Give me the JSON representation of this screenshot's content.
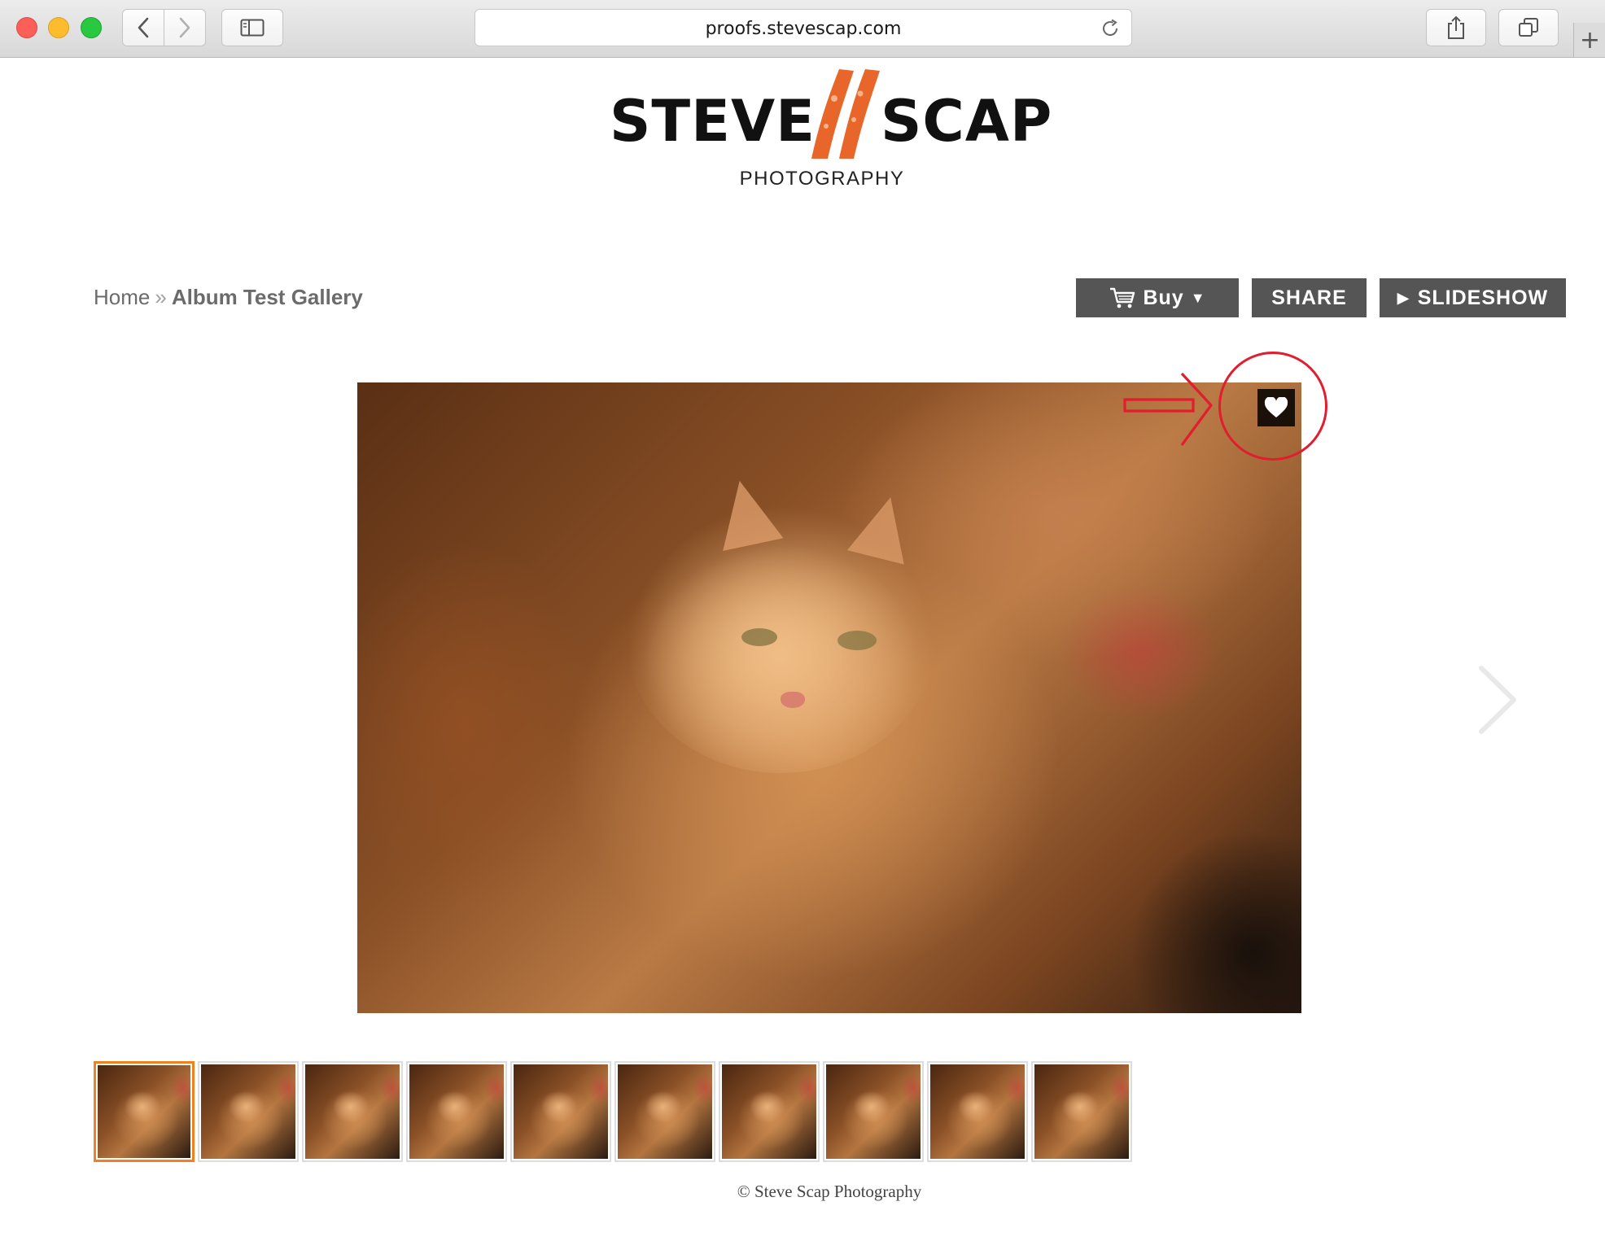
{
  "browser": {
    "url": "proofs.stevescap.com",
    "new_tab_glyph": "+"
  },
  "logo": {
    "first": "STEVE",
    "last": "SCAP",
    "subtitle": "PHOTOGRAPHY",
    "accent_color": "#e8662a"
  },
  "breadcrumb": {
    "home": "Home",
    "separator": "»",
    "current": "Album Test Gallery"
  },
  "actions": {
    "buy_label": "Buy",
    "buy_caret": "▼",
    "share_label": "SHARE",
    "slideshow_label": "SLIDESHOW",
    "slideshow_icon": "▶"
  },
  "photo": {
    "favorite_icon": "heart-icon",
    "annotation_color": "#e11d2e"
  },
  "filmstrip": {
    "thumbnails": [
      1,
      2,
      3,
      4,
      5,
      6,
      7,
      8,
      9,
      10
    ],
    "active_index": 0,
    "active_color": "#f08020"
  },
  "footer": {
    "copyright": "© Steve Scap Photography"
  }
}
